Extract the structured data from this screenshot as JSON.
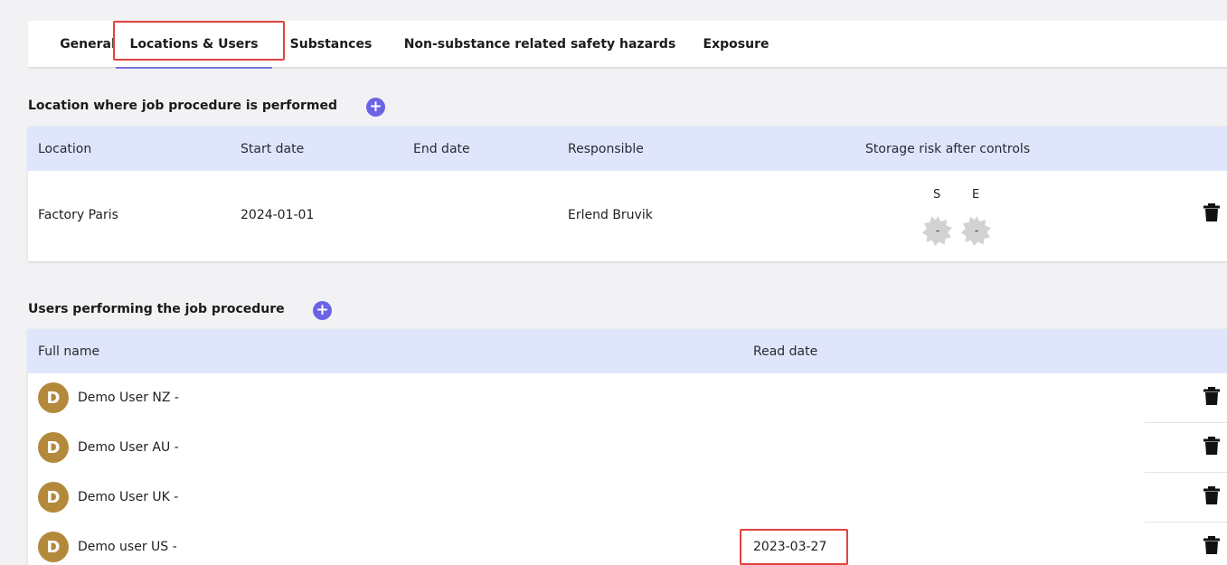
{
  "tabs": [
    {
      "label": "General"
    },
    {
      "label": "Locations & Users"
    },
    {
      "label": "Substances"
    },
    {
      "label": "Non-substance related safety hazards"
    },
    {
      "label": "Exposure"
    }
  ],
  "locations": {
    "title": "Location where job procedure is performed",
    "add_icon": "plus-icon",
    "columns": [
      "Location",
      "Start date",
      "End date",
      "Responsible",
      "Storage risk after controls"
    ],
    "rows": [
      {
        "location": "Factory Paris",
        "start_date": "2024-01-01",
        "end_date": "",
        "responsible": "Erlend Bruvik",
        "risk_s_label": "S",
        "risk_e_label": "E",
        "risk_s_value": "-",
        "risk_e_value": "-"
      }
    ]
  },
  "users": {
    "title": "Users performing the job procedure",
    "add_icon": "plus-icon",
    "columns": [
      "Full name",
      "Read date"
    ],
    "rows": [
      {
        "initial": "D",
        "name": "Demo User NZ -",
        "read_date": ""
      },
      {
        "initial": "D",
        "name": "Demo User AU -",
        "read_date": ""
      },
      {
        "initial": "D",
        "name": "Demo User UK -",
        "read_date": ""
      },
      {
        "initial": "D",
        "name": "Demo user US -",
        "read_date": "2023-03-27"
      }
    ]
  },
  "colors": {
    "accent": "#6b63e6",
    "header_bg": "#dfe6fb",
    "avatar": "#b38a3b",
    "highlight": "#e0433f",
    "risk_badge": "#d2d2d2"
  }
}
